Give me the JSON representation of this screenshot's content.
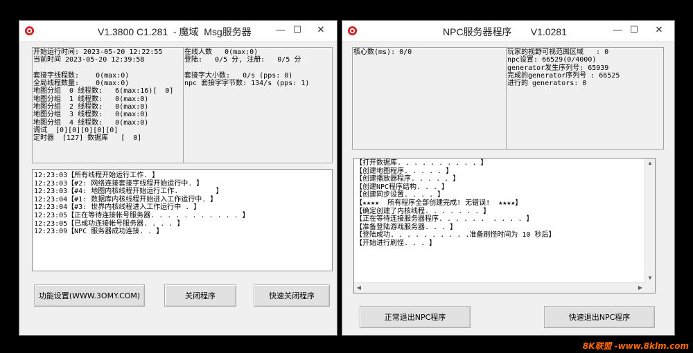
{
  "msg_window": {
    "title": "V1.3800 C1.281  - 魔域  Msg服务器",
    "controls": {
      "minimize": "—",
      "maximize": "☐",
      "close": "✕"
    },
    "stats_left": [
      "开始运行时间: 2023-05-20 12:22:55",
      "当前时间 2023-05-20 12:39:58",
      "",
      "套接字线程数:    0(max:0)",
      "全局线程数量:    0(max:0)",
      "地图分组  0 线程数:   6(max:16)[  0]",
      "地图分组  1 线程数:   0(max:0)",
      "地图分组  2 线程数:   0(max:0)",
      "地图分组  3 线程数:   0(max:0)",
      "地图分组  4 线程数:   0(max:0)",
      "调试  [0][0][0][0][0]",
      "定时器  [127] 数据库   [  0]"
    ],
    "stats_right": [
      "在线人数   0(max:0)",
      "登陆:   0/5 分, 注册:   0/5 分",
      "",
      "套接字大小数:   0/s (pps: 0)",
      "npc 套接字字节数: 134/s (pps: 1)"
    ],
    "log": [
      "12:23:03【所有线程开始运行工作. 】",
      "12:23:03【#2: 网络连接套接字线程开始运行中. 】",
      "12:23:03【#4: 地图内核线程开始运行工作.         】",
      "12:23:04【#1: 数据库内核线程开始进入工作运行中. 】",
      "12:23:04【#3: 世界内核线程进入工作运行中 . 】",
      "12:23:05【正在等待连接帐号服务器. . . . . . . . . . . 】",
      "12:23:05【已成功连接帐号服务器. . . . 】",
      "12:23:09【NPC 服务器成功连接. . 】"
    ],
    "buttons": {
      "settings": "功能设置(WWW.3OMY.COM)",
      "close_program": "关闭程序",
      "quick_close": "快速关闭程序"
    }
  },
  "npc_window": {
    "title": "NPC服务器程序       V1.0281",
    "controls": {
      "minimize": "—",
      "maximize": "☐",
      "close": "✕"
    },
    "stats_left": [
      "核心数(ms): 0/0"
    ],
    "stats_right": [
      "玩家的视野可视范围区域   : 0",
      "npc设置: 66529(0/4000)",
      "generator发生序列号: 65939",
      "完成的generator序列号 : 66525",
      "进行的 generators: 0"
    ],
    "log": [
      "【打开数据库. . . . . . . . . . 】",
      "【创建地图程序. . . . . 】",
      "【创建播放器程序. . . . . 】",
      "【创建NPC程序结构. . . 】",
      "【创建同步设置. . . . 】",
      "【★★★★  所有程序全部创建完成! 无错误!  ★★★★】",
      "【确定创建了内核线程. . . . . . . 】",
      "【正在等待连接服务器程序. . . . . .  . . . . 】",
      "【准备登陆游戏服务器. . . 】",
      "【登陆成功. . . . . . . . . .准备刷怪时间为 10 秒后】",
      "【开始进行刷怪. . . 】"
    ],
    "buttons": {
      "normal_exit": "正常退出NPC程序",
      "quick_exit": "快速退出NPC程序"
    }
  },
  "watermark": "8K联盟 -www.8klm.com"
}
